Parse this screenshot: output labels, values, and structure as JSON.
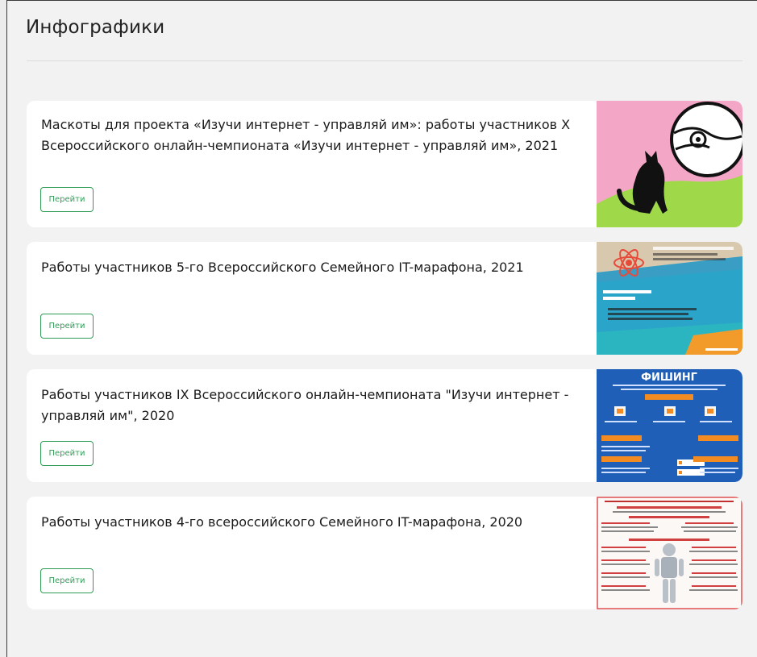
{
  "page": {
    "title": "Инфографики"
  },
  "colors": {
    "accent": "#2f9c55",
    "card_bg": "#ffffff",
    "page_bg": "#f2f2f2"
  },
  "cards": [
    {
      "title": "Маскоты для проекта «Изучи интернет - управляй им»: работы участников X Всероссийского онлайн-чемпионата «Изучи интернет - управляй им», 2021",
      "button_label": "Перейти",
      "image_name": "mascot-cat-planet-image"
    },
    {
      "title": "Работы участников 5-го Всероссийского Семейного IT-марафона, 2021",
      "button_label": "Перейти",
      "image_name": "internet-safety-poster-image"
    },
    {
      "title": "Работы участников IX Всероссийского онлайн-чемпионата \"Изучи интернет - управляй им\", 2020",
      "button_label": "Перейти",
      "image_name": "phishing-infographic-image",
      "image_heading": "ФИШИНГ"
    },
    {
      "title": "Работы участников 4-го всероссийского Семейного IT-марафона, 2020",
      "button_label": "Перейти",
      "image_name": "robot-infographic-image"
    }
  ]
}
